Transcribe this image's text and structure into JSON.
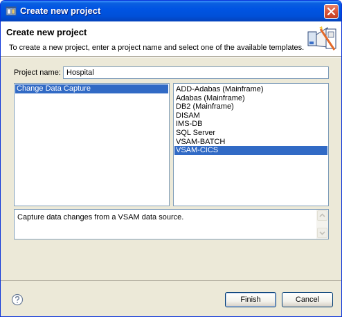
{
  "window": {
    "title": "Create new project"
  },
  "header": {
    "title": "Create new project",
    "description": "To create a new project, enter a project name and select one of the available templates."
  },
  "form": {
    "project_name_label": "Project name:",
    "project_name_value": "Hospital"
  },
  "categories": [
    {
      "label": "Change Data Capture",
      "selected": true
    }
  ],
  "templates": [
    {
      "label": "ADD-Adabas (Mainframe)",
      "selected": false
    },
    {
      "label": "Adabas (Mainframe)",
      "selected": false
    },
    {
      "label": "DB2 (Mainframe)",
      "selected": false
    },
    {
      "label": "DISAM",
      "selected": false
    },
    {
      "label": "IMS-DB",
      "selected": false
    },
    {
      "label": "SQL Server",
      "selected": false
    },
    {
      "label": "VSAM-BATCH",
      "selected": false
    },
    {
      "label": "VSAM-CICS",
      "selected": true
    }
  ],
  "template_description": "Capture data changes from a VSAM data source.",
  "buttons": {
    "finish": "Finish",
    "cancel": "Cancel"
  },
  "icons": {
    "window": "app-window-icon",
    "close": "close-icon",
    "wizard": "new-project-wizard-icon",
    "help": "help-icon"
  },
  "colors": {
    "selection": "#316ac5",
    "titlebar": "#0054e3",
    "dialog_bg": "#ece9d8"
  }
}
